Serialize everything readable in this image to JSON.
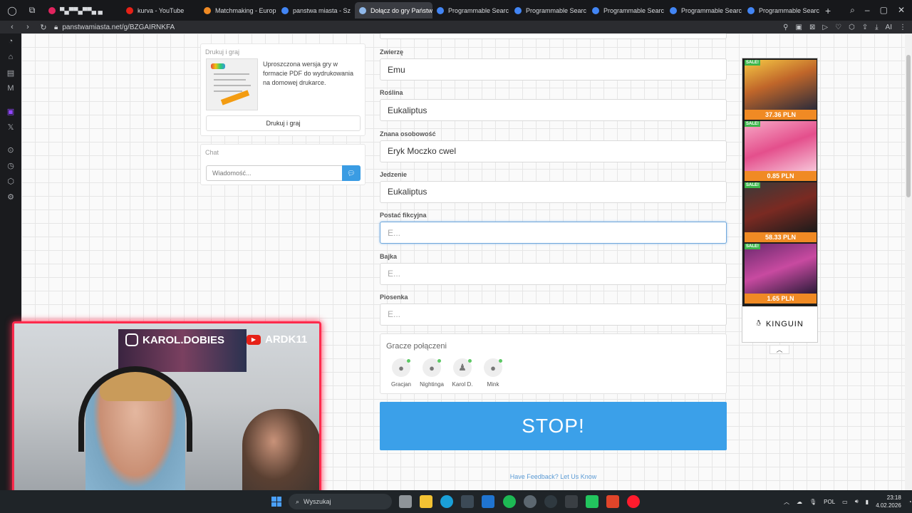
{
  "browser": {
    "tabs": [
      {
        "label": "▀▄▀▀▄▀▀▄ ▄",
        "color": "#e0245e",
        "active": false
      },
      {
        "label": "kurva - YouTube",
        "color": "#e62117",
        "active": false
      },
      {
        "label": "Matchmaking - Europ",
        "color": "#f08a24",
        "active": false
      },
      {
        "label": "panstwa miasta - Sz",
        "color": "#4285f4",
        "active": false
      },
      {
        "label": "Dołącz do gry Państwa M",
        "color": "#8fb8ea",
        "active": true
      },
      {
        "label": "Programmable Searc",
        "color": "#4285f4",
        "active": false
      },
      {
        "label": "Programmable Searc",
        "color": "#4285f4",
        "active": false
      },
      {
        "label": "Programmable Searc",
        "color": "#4285f4",
        "active": false
      },
      {
        "label": "Programmable Searc",
        "color": "#4285f4",
        "active": false
      },
      {
        "label": "Programmable Searc",
        "color": "#4285f4",
        "active": false
      }
    ],
    "url": "panstwamiasta.net/g/BZGAIRNKFA"
  },
  "print_panel": {
    "title": "Drukuj i graj",
    "description": "Uproszczona wersja gry w formacie PDF do wydrukowania na domowej drukarce.",
    "button": "Drukuj i graj"
  },
  "chat_panel": {
    "title": "Chat",
    "placeholder": "Wiadomość..."
  },
  "form": {
    "fields": [
      {
        "label": "Zwierzę",
        "value": "Emu",
        "placeholder": ""
      },
      {
        "label": "Roślina",
        "value": "Eukaliptus",
        "placeholder": ""
      },
      {
        "label": "Znana osobowość",
        "value": "Eryk Moczko cwel",
        "placeholder": ""
      },
      {
        "label": "Jedzenie",
        "value": "Eukaliptus",
        "placeholder": ""
      },
      {
        "label": "Postać fikcyjna",
        "value": "",
        "placeholder": "E..."
      },
      {
        "label": "Bajka",
        "value": "",
        "placeholder": "E..."
      },
      {
        "label": "Piosenka",
        "value": "",
        "placeholder": "E..."
      }
    ]
  },
  "players": {
    "title": "Gracze połączeni",
    "list": [
      "Gracjan",
      "Nightinga",
      "Karol D.",
      "Mink"
    ]
  },
  "stop_button": "STOP!",
  "feedback_link": "Have Feedback? Let Us Know",
  "ad": {
    "sale_badge": "SALE!",
    "prices": [
      "37.36 PLN",
      "0.85 PLN",
      "58.33 PLN",
      "1.65 PLN"
    ],
    "brand": "KINGUIN"
  },
  "stream_overlay": {
    "handle1": "KAROL.DOBIES",
    "handle2": "ARDK11"
  },
  "taskbar": {
    "search": "Wyszukaj",
    "lang": "POL",
    "time": "23:18",
    "date": "4.02.2026"
  }
}
